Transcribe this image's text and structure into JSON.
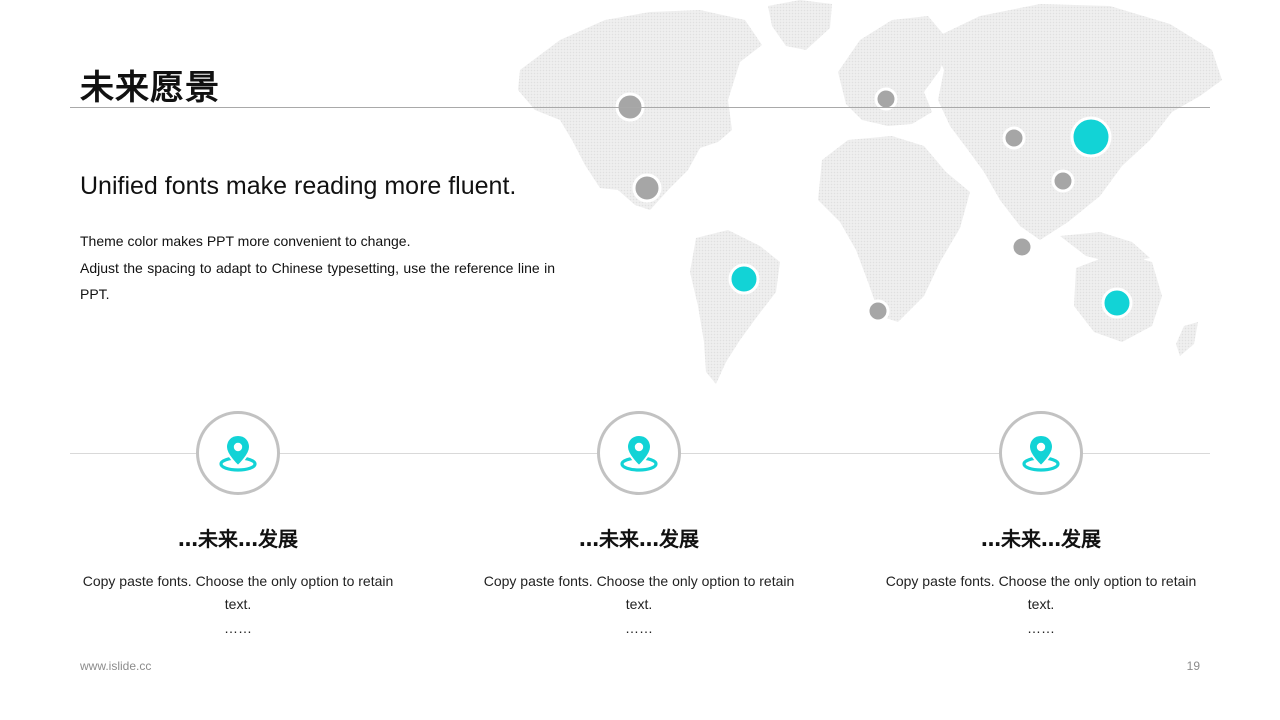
{
  "title": "未来愿景",
  "subtitle": "Unified fonts make reading more fluent.",
  "description": [
    "Theme color makes PPT more convenient to change.",
    "Adjust the spacing to adapt to Chinese typesetting, use the reference line in PPT."
  ],
  "cards": [
    {
      "icon": "location-pin-icon",
      "title": "…未来…发展",
      "text": "Copy paste fonts. Choose the only option to retain text.",
      "more": "……"
    },
    {
      "icon": "location-pin-icon",
      "title": "…未来…发展",
      "text": "Copy paste fonts. Choose the only option to retain text.",
      "more": "……"
    },
    {
      "icon": "location-pin-icon",
      "title": "…未来…发展",
      "text": "Copy paste fonts. Choose the only option to retain text.",
      "more": "……"
    }
  ],
  "footer": {
    "website": "www.islide.cc",
    "page_number": "19"
  },
  "colors": {
    "accent": "#12d3d6",
    "marker_gray": "#a6a6a6",
    "map_fill": "#ededed"
  }
}
